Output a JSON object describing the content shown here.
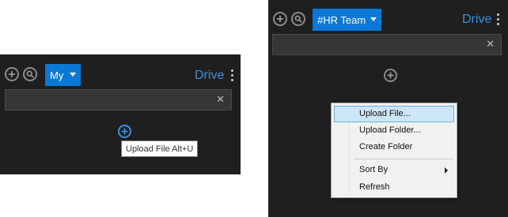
{
  "left_panel": {
    "drive_selector": {
      "label": "My"
    },
    "drive_label": "Drive",
    "search": {
      "value": "",
      "placeholder": ""
    },
    "clear_symbol": "✕",
    "tooltip": "Upload File Alt+U"
  },
  "right_panel": {
    "drive_selector": {
      "label": "#HR Team"
    },
    "drive_label": "Drive",
    "search": {
      "value": "",
      "placeholder": ""
    },
    "clear_symbol": "✕"
  },
  "context_menu": {
    "items": [
      {
        "label": "Upload File...",
        "highlighted": true
      },
      {
        "label": "Upload Folder..."
      },
      {
        "label": "Create Folder"
      },
      {
        "label": "Sort By",
        "has_submenu": true
      },
      {
        "label": "Refresh"
      }
    ]
  },
  "colors": {
    "panel_bg": "#1f1f1f",
    "accent": "#0a78d7",
    "drive_text": "#3d8fdc",
    "menu_highlight": "#cde6f7"
  },
  "icons": {
    "add": "plus-circle-icon",
    "search": "magnifier-circle-icon",
    "upload": "plus-circle-icon",
    "more": "kebab-icon"
  }
}
